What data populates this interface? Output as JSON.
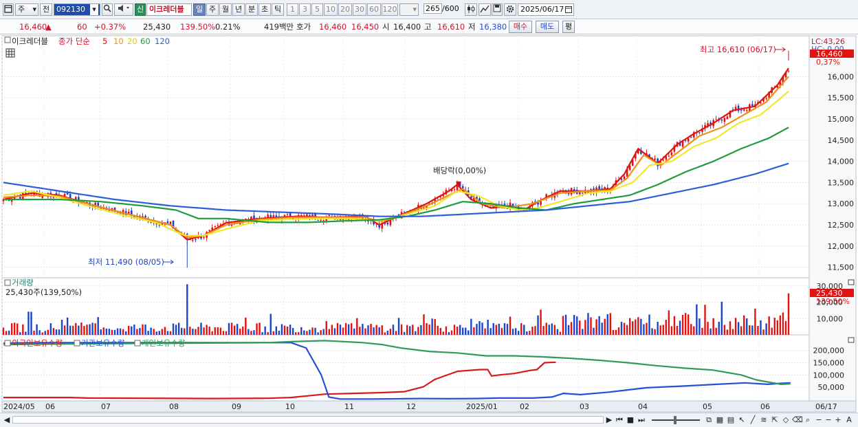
{
  "toolbar": {
    "mode": "주",
    "prefix": "전",
    "code": "092130",
    "new_btn": "신",
    "name": "이크레더블",
    "periods": [
      "일",
      "주",
      "월",
      "년",
      "분",
      "초",
      "틱"
    ],
    "active_period": "일",
    "intervals": [
      "1",
      "3",
      "5",
      "10",
      "20",
      "30",
      "60",
      "120"
    ],
    "count": "265",
    "count_total": "/600",
    "date": "2025/06/17"
  },
  "quote": {
    "price": "16,460",
    "arrow": "▲",
    "change": "60",
    "change_pct": "+0.37%",
    "volume": "25,430",
    "volume_ratio": "139.50%",
    "turnover": "0.21%",
    "amount": "419백만",
    "ask_label": "호가",
    "ask": "16,460",
    "bid": "16,450",
    "open_label": "시",
    "open": "16,400",
    "high_label": "고",
    "high": "16,610",
    "low_label": "저",
    "low": "16,380",
    "buy_label": "매수",
    "sell_label": "매도",
    "eval_label": "평"
  },
  "legend": {
    "name": "이크레더블",
    "ma_label": "종가 단순",
    "ma_periods": [
      "5",
      "10",
      "20",
      "60",
      "120"
    ]
  },
  "annotations": {
    "high": "최고 16,610 (06/17)",
    "low": "최저 11,490 (08/05)",
    "dividend": "배당락(0,00%)",
    "lc": "LC:43,26",
    "hc": "HC: 0,00",
    "last_price": "16,460",
    "last_pct": "0,37%"
  },
  "volume_panel": {
    "title": "거래량",
    "info": "25,430주(139,50%)",
    "last": "25,430",
    "last_pct": "139,50%"
  },
  "holdings_panel": {
    "series": [
      "외국인보유수량",
      "기관보유수량",
      "개인보유수량"
    ]
  },
  "colors": {
    "ma5": "#e01212",
    "ma10": "#f0901a",
    "ma20": "#f0e828",
    "ma60": "#1f9c3c",
    "ma120": "#2c5ed8",
    "up": "#e01212",
    "down": "#1c44c8",
    "foreign": "#d81a1a",
    "institution": "#2450d8",
    "individual": "#2e9a5c"
  },
  "chart_data": [
    {
      "type": "candlestick",
      "title": "이크레더블",
      "yaxis": [
        "11,500",
        "12,000",
        "12,500",
        "13,000",
        "13,500",
        "14,000",
        "14,500",
        "15,000",
        "15,500",
        "16,000"
      ],
      "ylim": [
        11300,
        16850
      ],
      "x_labels": [
        "2024/05",
        "06",
        "07",
        "08",
        "09",
        "10",
        "11",
        "12",
        "2025/01",
        "02",
        "03",
        "04",
        "05",
        "06",
        "06/17"
      ],
      "series": [
        {
          "name": "5",
          "points": [
            [
              0,
              13100
            ],
            [
              10,
              13250
            ],
            [
              20,
              13200
            ],
            [
              33,
              12950
            ],
            [
              45,
              12750
            ],
            [
              60,
              12500
            ],
            [
              66,
              12150
            ],
            [
              72,
              12250
            ],
            [
              80,
              12550
            ],
            [
              92,
              12650
            ],
            [
              105,
              12700
            ],
            [
              117,
              12680
            ],
            [
              130,
              12700
            ],
            [
              135,
              12500
            ],
            [
              140,
              12650
            ],
            [
              152,
              13000
            ],
            [
              160,
              13300
            ],
            [
              163,
              13450
            ],
            [
              168,
              13100
            ],
            [
              175,
              12900
            ],
            [
              182,
              12950
            ],
            [
              187,
              12850
            ],
            [
              192,
              13050
            ],
            [
              200,
              13300
            ],
            [
              210,
              13300
            ],
            [
              218,
              13350
            ],
            [
              223,
              13700
            ],
            [
              228,
              14300
            ],
            [
              235,
              13950
            ],
            [
              242,
              14400
            ],
            [
              248,
              14650
            ],
            [
              255,
              14900
            ],
            [
              262,
              15200
            ],
            [
              270,
              15300
            ],
            [
              278,
              15800
            ],
            [
              282,
              16200
            ]
          ]
        },
        {
          "name": "10",
          "points": [
            [
              0,
              13150
            ],
            [
              10,
              13200
            ],
            [
              20,
              13180
            ],
            [
              33,
              12950
            ],
            [
              45,
              12750
            ],
            [
              60,
              12500
            ],
            [
              66,
              12200
            ],
            [
              72,
              12250
            ],
            [
              80,
              12500
            ],
            [
              92,
              12630
            ],
            [
              105,
              12680
            ],
            [
              117,
              12680
            ],
            [
              130,
              12680
            ],
            [
              135,
              12580
            ],
            [
              140,
              12650
            ],
            [
              152,
              12950
            ],
            [
              160,
              13200
            ],
            [
              165,
              13350
            ],
            [
              172,
              13000
            ],
            [
              180,
              12900
            ],
            [
              190,
              13000
            ],
            [
              200,
              13250
            ],
            [
              210,
              13300
            ],
            [
              218,
              13320
            ],
            [
              224,
              13600
            ],
            [
              230,
              14150
            ],
            [
              236,
              13900
            ],
            [
              244,
              14300
            ],
            [
              250,
              14600
            ],
            [
              258,
              14800
            ],
            [
              266,
              15100
            ],
            [
              274,
              15400
            ],
            [
              282,
              16000
            ]
          ]
        },
        {
          "name": "20",
          "points": [
            [
              0,
              13200
            ],
            [
              10,
              13300
            ],
            [
              20,
              13150
            ],
            [
              33,
              12900
            ],
            [
              45,
              12700
            ],
            [
              55,
              12550
            ],
            [
              65,
              12250
            ],
            [
              72,
              12250
            ],
            [
              80,
              12400
            ],
            [
              92,
              12600
            ],
            [
              110,
              12650
            ],
            [
              125,
              12650
            ],
            [
              135,
              12600
            ],
            [
              145,
              12750
            ],
            [
              155,
              12950
            ],
            [
              163,
              13300
            ],
            [
              170,
              13200
            ],
            [
              178,
              12950
            ],
            [
              185,
              12850
            ],
            [
              192,
              12900
            ],
            [
              200,
              13050
            ],
            [
              210,
              13250
            ],
            [
              218,
              13300
            ],
            [
              226,
              13500
            ],
            [
              232,
              13900
            ],
            [
              240,
              14000
            ],
            [
              248,
              14350
            ],
            [
              256,
              14550
            ],
            [
              264,
              14900
            ],
            [
              272,
              15100
            ],
            [
              282,
              15650
            ]
          ]
        },
        {
          "name": "60",
          "points": [
            [
              0,
              13100
            ],
            [
              10,
              13100
            ],
            [
              20,
              13100
            ],
            [
              35,
              13050
            ],
            [
              50,
              12950
            ],
            [
              62,
              12850
            ],
            [
              70,
              12650
            ],
            [
              80,
              12650
            ],
            [
              95,
              12560
            ],
            [
              110,
              12560
            ],
            [
              125,
              12600
            ],
            [
              135,
              12620
            ],
            [
              145,
              12700
            ],
            [
              155,
              12850
            ],
            [
              165,
              13050
            ],
            [
              175,
              13000
            ],
            [
              185,
              12900
            ],
            [
              195,
              12850
            ],
            [
              205,
              13000
            ],
            [
              215,
              13100
            ],
            [
              225,
              13200
            ],
            [
              235,
              13450
            ],
            [
              245,
              13750
            ],
            [
              255,
              14000
            ],
            [
              265,
              14300
            ],
            [
              275,
              14550
            ],
            [
              282,
              14800
            ]
          ]
        },
        {
          "name": "120",
          "points": [
            [
              0,
              13500
            ],
            [
              20,
              13300
            ],
            [
              40,
              13100
            ],
            [
              60,
              12950
            ],
            [
              80,
              12850
            ],
            [
              100,
              12800
            ],
            [
              120,
              12750
            ],
            [
              135,
              12700
            ],
            [
              150,
              12700
            ],
            [
              165,
              12750
            ],
            [
              180,
              12800
            ],
            [
              195,
              12850
            ],
            [
              210,
              12950
            ],
            [
              225,
              13050
            ],
            [
              240,
              13250
            ],
            [
              255,
              13450
            ],
            [
              270,
              13700
            ],
            [
              282,
              13950
            ]
          ]
        }
      ],
      "high_label": {
        "date": "06/17",
        "value": 16610
      },
      "low_label": {
        "date": "08/05",
        "value": 11490
      },
      "last": 16460
    },
    {
      "type": "bar",
      "title": "거래량",
      "yaxis": [
        "10,000",
        "20,000",
        "30,000"
      ],
      "ylim": [
        0,
        32000
      ],
      "last": 25430
    },
    {
      "type": "line",
      "title": "보유수량",
      "yaxis": [
        "50,000",
        "100,000",
        "150,000",
        "200,000"
      ],
      "ylim": [
        0,
        230000
      ],
      "series": [
        {
          "name": "외국인보유수량",
          "points": [
            [
              0,
              8000
            ],
            [
              35,
              8000
            ],
            [
              45,
              6000
            ],
            [
              110,
              4000
            ],
            [
              140,
              5000
            ],
            [
              152,
              8000
            ],
            [
              170,
              22000
            ],
            [
              200,
              28000
            ],
            [
              212,
              32000
            ],
            [
              222,
              52000
            ],
            [
              228,
              82000
            ],
            [
              240,
              115000
            ],
            [
              252,
              122000
            ],
            [
              256,
              122000
            ],
            [
              258,
              96000
            ],
            [
              262,
              100000
            ],
            [
              270,
              106000
            ],
            [
              278,
              118000
            ],
            [
              282,
              122000
            ],
            [
              286,
              150000
            ],
            [
              292,
              152000
            ]
          ]
        },
        {
          "name": "기관보유수량",
          "points": [
            [
              0,
              230000
            ],
            [
              20,
              232000
            ],
            [
              60,
              232000
            ],
            [
              100,
              232000
            ],
            [
              140,
              232000
            ],
            [
              152,
              232000
            ],
            [
              160,
              210000
            ],
            [
              168,
              100000
            ],
            [
              172,
              10000
            ],
            [
              178,
              2000
            ],
            [
              195,
              2000
            ],
            [
              220,
              4000
            ],
            [
              235,
              3000
            ],
            [
              250,
              4000
            ],
            [
              262,
              6000
            ],
            [
              280,
              6000
            ],
            [
              290,
              10000
            ],
            [
              296,
              25000
            ],
            [
              305,
              20000
            ],
            [
              320,
              30000
            ],
            [
              340,
              48000
            ],
            [
              360,
              55000
            ],
            [
              372,
              60000
            ],
            [
              392,
              68000
            ],
            [
              404,
              62000
            ],
            [
              411,
              66000
            ],
            [
              416,
              68000
            ]
          ]
        },
        {
          "name": "개인보유수량",
          "points": [
            [
              0,
              224000
            ],
            [
              20,
              226000
            ],
            [
              60,
              228000
            ],
            [
              100,
              230000
            ],
            [
              140,
              232000
            ],
            [
              152,
              236000
            ],
            [
              170,
              240000
            ],
            [
              190,
              232000
            ],
            [
              200,
              224000
            ],
            [
              210,
              210000
            ],
            [
              225,
              196000
            ],
            [
              240,
              190000
            ],
            [
              255,
              178000
            ],
            [
              270,
              178000
            ],
            [
              285,
              174000
            ],
            [
              300,
              168000
            ],
            [
              315,
              160000
            ],
            [
              330,
              150000
            ],
            [
              345,
              138000
            ],
            [
              360,
              128000
            ],
            [
              375,
              120000
            ],
            [
              390,
              100000
            ],
            [
              398,
              80000
            ],
            [
              405,
              70000
            ],
            [
              411,
              62000
            ],
            [
              416,
              64000
            ]
          ]
        }
      ]
    }
  ]
}
